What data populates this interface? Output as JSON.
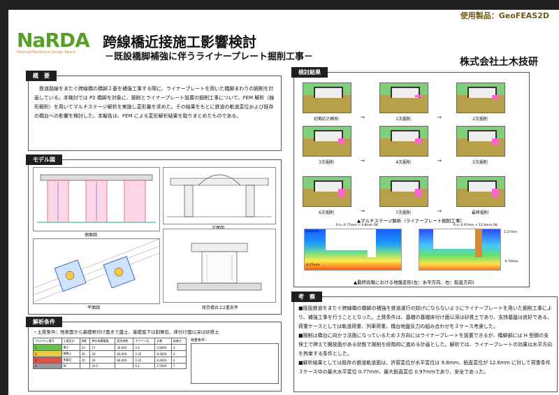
{
  "product": "使用製品：GeoFEAS2D",
  "logo": {
    "word": "NaRDA",
    "sub": "National Resilience Design Award"
  },
  "title": "跨線橋近接施工影響検討",
  "subtitle": "－既設橋脚補強に伴うライナープレート掘削工事－",
  "company": "株式会社土木技研",
  "sections": {
    "overview": "概　要",
    "model": "モデル図",
    "calc": "解析条件",
    "result": "検討結果",
    "consider": "考　察"
  },
  "overview_text": "　鉄道路線をまたぐ跨線橋の橋脚２基を補強工事する際に、ライナープレートを用いた橋脚まわりの掘削を計画している。本検討では P2 橋脚を対象に、掘削とライナープレート設置の掘削工事について、FEM 解析（線形解析）を用いてマルチステージ解析を実施し変形量を求めた。その結果をもとに鉄道の軌道変位および既存の橋台への影響を検討した。本報告は、FEM による変形解析結果を取りまとめたものである。",
  "model_captions": [
    "側面図",
    "正面図",
    "平面図",
    "既存橋台上2重条件"
  ],
  "calc_condition": "・土質条件：地表面から基礎根付け面まで盛土、基礎直下は割栗石、床付け面以深は砂質土",
  "calc_table": {
    "headers": [
      "プロパティ番号",
      "土質区分",
      "N値",
      "単位体積重量",
      "変形係数",
      "ポアソン比",
      "反数",
      "粘着力"
    ],
    "rows": [
      [
        "1",
        "盛土",
        "10",
        "17",
        "28,000",
        "0.4",
        "2.8000",
        "4"
      ],
      [
        "2",
        "礫質土",
        "30",
        "20",
        "84,000",
        "0.35",
        "8.4000",
        "4"
      ],
      [
        "3",
        "割栗石",
        "30",
        "20",
        "84,000",
        "0.35",
        "8.4000",
        "4"
      ],
      [
        "4",
        "RC",
        "",
        "24.5",
        "",
        "0.2",
        "2.5000",
        "7"
      ]
    ],
    "load_title": "荷重条件："
  },
  "stages": [
    {
      "label": "初期応力解析"
    },
    {
      "label": "1次掘削"
    },
    {
      "label": "2次掘削"
    },
    {
      "label": "3次掘削"
    },
    {
      "label": "4次掘削"
    },
    {
      "label": "5次掘削"
    },
    {
      "label": "6次掘削"
    },
    {
      "label": "7次掘削"
    },
    {
      "label": "最終掘削"
    }
  ],
  "arrow": "→",
  "multistage_caption": "▲マルチステージ解析（ライナープレート掘削工事）",
  "contour_caption": "▲最終段階における地盤変形(左：水平方向、右：鉛直方向)",
  "contour_left": {
    "top": "δ h=0.77mm < 9.8mm OK",
    "max": "0.81mm",
    "min": "-0.25mm"
  },
  "contour_right": {
    "top": "δ v=0.97mm < 12.6mm OK",
    "max": "1.27mm",
    "min": "-0.79mm"
  },
  "consider_items": [
    "■既設鉄道をまたぐ跨線橋の橋脚の補強を鉄道運行の妨げにならないようにライナープレートを用いた掘削工事により、補強工事を行うこととなった。土質条件は、基礎の基礎床付け面以深は砂質土であり、支持基盤は良好である。荷重ケースとしては軌道荷重、列車荷重、橋台地盤反力の組み合わせを３ケース考慮した。",
    "■掘削は橋台に向かう法面になっているため３方向にはライナープレートを設置できるが、橋脚部には H 型鋼の支保工で押えて開放面がある状態で掘削を段階的に進める計画とした。解析では、ライナープレートの効果は水平方向を拘束する条件とした。",
    "■解析結果としては既存の鉄道軌道面は、許容変位が水平変位は 9.8mm、鉛直変位が 12.6mm に対して荷重条件３ケース中の最大水平変位 0.77mm、最大鉛直変位 0.97mmであり、安全であった。"
  ],
  "colors": {
    "accent": "#5a9e2a",
    "dark": "#1f1f1f",
    "cut": "#ff66cc"
  }
}
